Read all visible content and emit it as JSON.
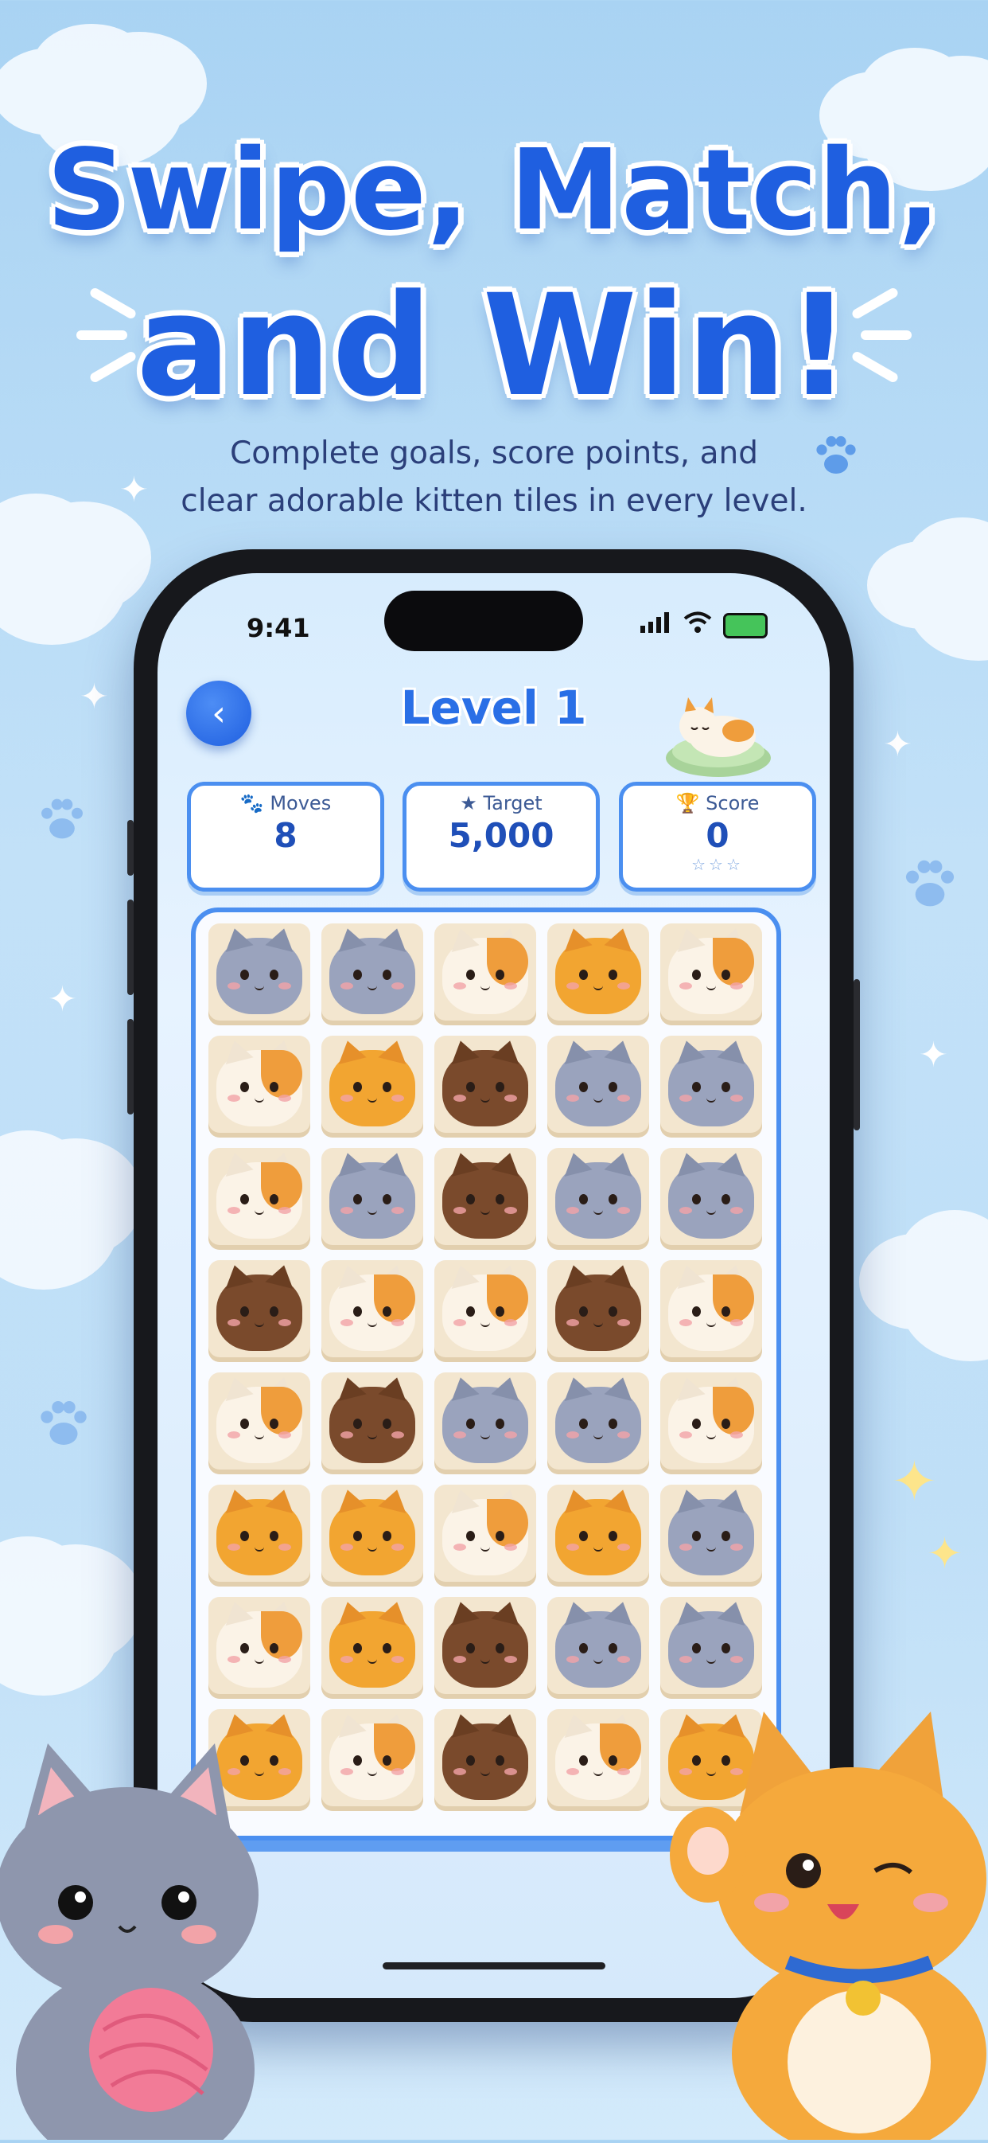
{
  "headline": {
    "line1": "Swipe, Match,",
    "line2": "and Win!"
  },
  "subtitle": {
    "line1": "Complete goals, score points, and",
    "line2": "clear adorable kitten tiles in every level."
  },
  "status_bar": {
    "time": "9:41"
  },
  "game": {
    "level_title": "Level 1",
    "moves": {
      "label": "Moves",
      "value": "8"
    },
    "target": {
      "label": "Target",
      "value": "5,000"
    },
    "score": {
      "label": "Score",
      "value": "0",
      "stars": "☆☆☆"
    }
  },
  "board": {
    "rows": [
      [
        "gray",
        "gray",
        "calico",
        "orange",
        "calico"
      ],
      [
        "calico",
        "orange",
        "brown",
        "gray",
        "gray"
      ],
      [
        "calico",
        "gray",
        "brown",
        "gray",
        "gray"
      ],
      [
        "brown",
        "calico",
        "calico",
        "brown",
        "calico"
      ],
      [
        "calico",
        "brown",
        "gray",
        "gray",
        "calico"
      ],
      [
        "orange",
        "orange",
        "calico",
        "orange",
        "gray"
      ],
      [
        "calico",
        "orange",
        "brown",
        "gray",
        "gray"
      ],
      [
        "orange",
        "calico",
        "brown",
        "calico",
        "orange"
      ]
    ]
  },
  "colors": {
    "accent": "#1f5fe0",
    "gray": "#9aa3bd",
    "orange": "#f2a531",
    "brown": "#7a4a2c",
    "calico": "#fbf3e7"
  }
}
